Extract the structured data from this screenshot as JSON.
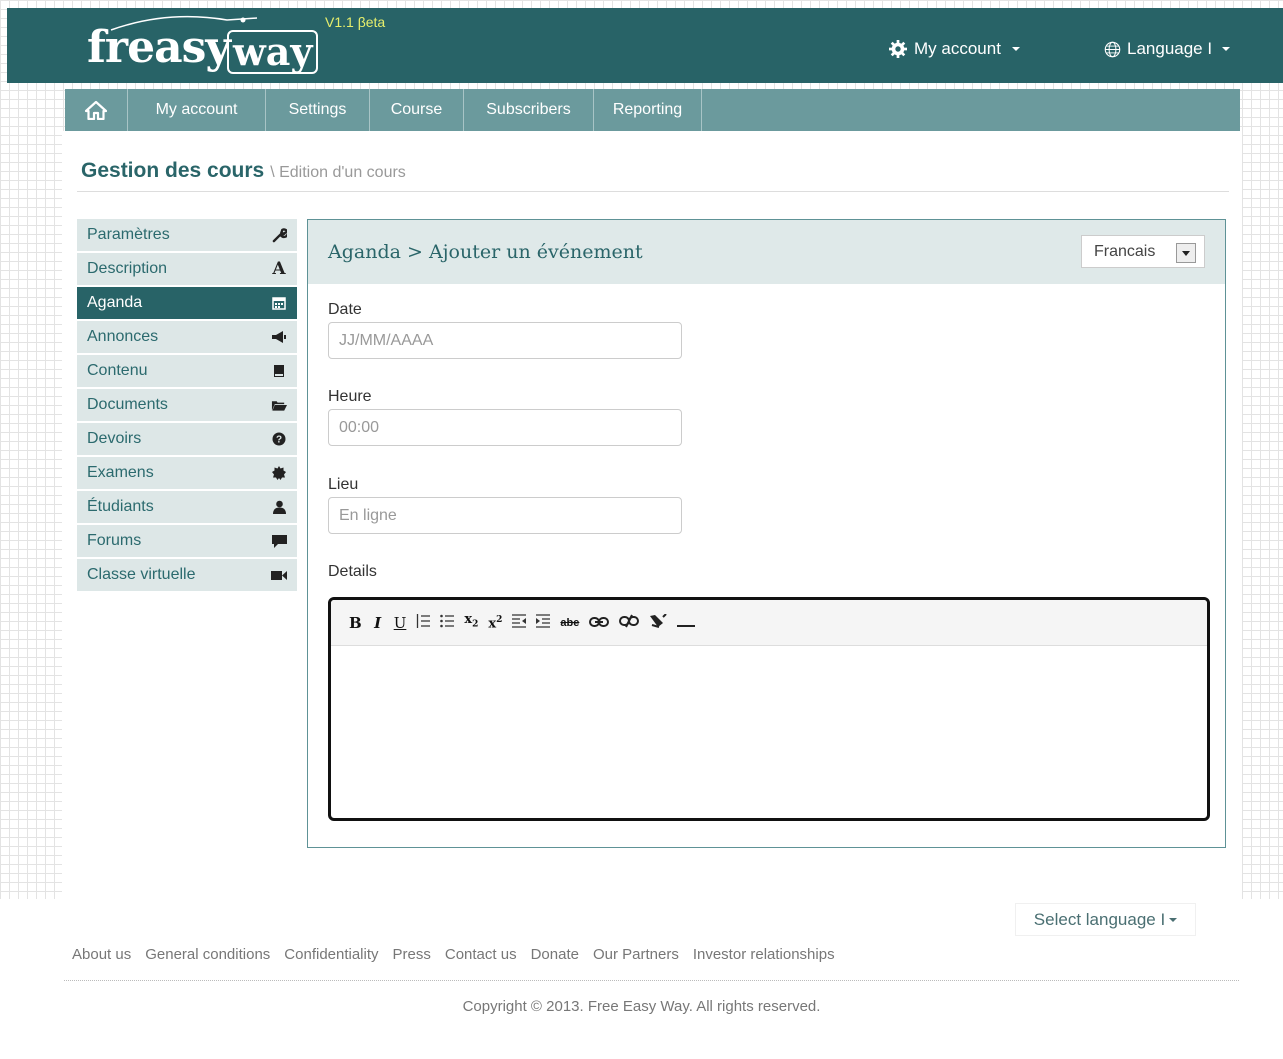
{
  "brand": {
    "logo_main": "freasy",
    "logo_box": "way",
    "version": "V1.1 βeta"
  },
  "top": {
    "account_label": "My account",
    "language_label": "Language I"
  },
  "nav": {
    "items": [
      {
        "label": "My account"
      },
      {
        "label": "Settings"
      },
      {
        "label": "Course"
      },
      {
        "label": "Subscribers"
      },
      {
        "label": "Reporting"
      }
    ]
  },
  "page": {
    "title": "Gestion des cours",
    "subtitle": "\\ Edition d'un cours"
  },
  "sidebar": {
    "items": [
      {
        "label": "Paramètres",
        "icon": "wrench-icon"
      },
      {
        "label": "Description",
        "icon": "font-icon"
      },
      {
        "label": "Aganda",
        "icon": "calendar-icon",
        "active": true
      },
      {
        "label": "Annonces",
        "icon": "bullhorn-icon"
      },
      {
        "label": "Contenu",
        "icon": "book-icon"
      },
      {
        "label": "Documents",
        "icon": "folder-open-icon"
      },
      {
        "label": "Devoirs",
        "icon": "question-icon"
      },
      {
        "label": "Examens",
        "icon": "certificate-icon"
      },
      {
        "label": "Étudiants",
        "icon": "user-icon"
      },
      {
        "label": "Forums",
        "icon": "comment-icon"
      },
      {
        "label": "Classe virtuelle",
        "icon": "video-icon"
      }
    ]
  },
  "panel": {
    "title": "Aganda > Ajouter un événement",
    "language": "Francais",
    "fields": {
      "date": {
        "label": "Date",
        "placeholder": "JJ/MM/AAAA",
        "value": ""
      },
      "time": {
        "label": "Heure",
        "placeholder": "00:00",
        "value": ""
      },
      "place": {
        "label": "Lieu",
        "placeholder": "En ligne",
        "value": ""
      },
      "details": {
        "label": "Details"
      }
    },
    "toolbar": [
      "B",
      "I",
      "U",
      "ordered-list",
      "unordered-list",
      "subscript",
      "superscript",
      "outdent",
      "indent",
      "strikethrough",
      "link",
      "unlink",
      "remove-format",
      "horizontal-rule"
    ]
  },
  "footer": {
    "language_label": "Select language I",
    "links": [
      {
        "label": "About us"
      },
      {
        "label": "General conditions"
      },
      {
        "label": "Confidentiality"
      },
      {
        "label": "Press"
      },
      {
        "label": "Contact us"
      },
      {
        "label": "Donate"
      },
      {
        "label": "Our Partners"
      },
      {
        "label": "Investor relationships"
      }
    ],
    "copyright": "Copyright © 2013. Free Easy Way. All rights reserved."
  },
  "colors": {
    "header": "#286367",
    "nav": "#6b9a9d",
    "accent_text": "#2a6569",
    "version": "#e6ee6c"
  }
}
